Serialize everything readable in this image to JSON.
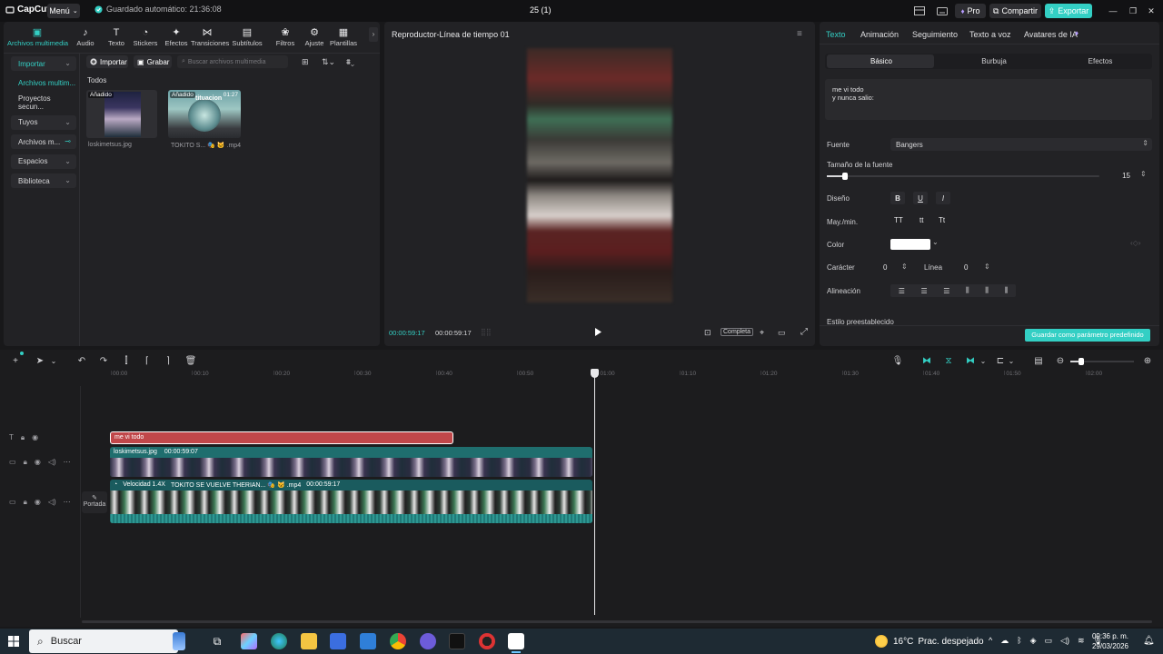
{
  "app": {
    "logo_text": "CapCut",
    "menu_label": "Menú",
    "autosave_text": "Guardado automático: 21:36:08",
    "project_title": "25 (1)",
    "pro_label": "Pro",
    "share_label": "Compartir",
    "export_label": "Exportar"
  },
  "media_panel": {
    "categories": [
      {
        "label": "Archivos multimedia",
        "icon": "media-icon",
        "active": true
      },
      {
        "label": "Audio",
        "icon": "audio-icon"
      },
      {
        "label": "Texto",
        "icon": "text-icon"
      },
      {
        "label": "Stickers",
        "icon": "sticker-icon"
      },
      {
        "label": "Efectos",
        "icon": "effects-icon"
      },
      {
        "label": "Transiciones",
        "icon": "transitions-icon"
      },
      {
        "label": "Subtítulos",
        "icon": "subtitles-icon"
      },
      {
        "label": "Filtros",
        "icon": "filters-icon"
      },
      {
        "label": "Ajuste",
        "icon": "adjust-icon"
      },
      {
        "label": "Plantillas",
        "icon": "templates-icon"
      }
    ],
    "sidebar": [
      {
        "label": "Importar",
        "chevron": true,
        "bg": true
      },
      {
        "label": "Archivos multim...",
        "active": true
      },
      {
        "label": "Proyectos secun..."
      },
      {
        "label": "Tuyos",
        "chevron": true
      },
      {
        "label": "Archivos m...",
        "toggle": true
      },
      {
        "label": "Espacios",
        "chevron": true
      },
      {
        "label": "Biblioteca",
        "chevron": true
      }
    ],
    "import_btn": "Importar",
    "record_btn": "Grabar",
    "search_placeholder": "Buscar archivos multimedia",
    "section_title": "Todos",
    "items": [
      {
        "badge": "Añadido",
        "name": "loskimetsus.jpg",
        "duration": ""
      },
      {
        "badge": "Añadido",
        "name": "TOKITO S... 🎭 🐱 .mp4",
        "duration": "01:27",
        "overlay": "tituacion"
      }
    ]
  },
  "player": {
    "title": "Reproductor-Línea de tiempo 01",
    "current_time": "00:00:59:17",
    "total_time": "00:00:59:17",
    "complete_label": "Completa"
  },
  "props": {
    "tabs": [
      "Texto",
      "Animación",
      "Seguimiento",
      "Texto a voz",
      "Avatares de IA"
    ],
    "subtabs": [
      "Básico",
      "Burbuja",
      "Efectos"
    ],
    "text_content": [
      "me vi todo",
      "y nunca salio:"
    ],
    "font_label": "Fuente",
    "font_value": "Bangers",
    "size_label": "Tamaño de la fuente",
    "size_value": "15",
    "size_fraction": 0.03,
    "design_label": "Diseño",
    "case_label": "May./min.",
    "case_options": [
      "TT",
      "tt",
      "Tt"
    ],
    "color_label": "Color",
    "color_value": "#ffffff",
    "char_label": "Carácter",
    "char_value": "0",
    "line_label": "Línea",
    "line_value": "0",
    "align_label": "Alineación",
    "preset_label": "Estilo preestablecido",
    "save_default_btn": "Guardar como parámetro predefinido"
  },
  "timeline": {
    "ticks": [
      "00:00",
      "00:10",
      "00:20",
      "00:30",
      "00:40",
      "00:50",
      "01:00",
      "01:10",
      "01:20",
      "01:30",
      "01:40",
      "01:50",
      "02:00"
    ],
    "text_clip": "me vi todo",
    "image_clip": {
      "name": "loskimetsus.jpg",
      "duration": "00:00:59:07"
    },
    "video_clip": {
      "speed": "Velocidad 1.4X",
      "name": "TOKITO SE VUELVE THERIAN... 🎭 🐱 .mp4",
      "duration": "00:00:59:17"
    },
    "cover_label": "Portada"
  },
  "taskbar": {
    "search_placeholder": "Buscar",
    "weather_temp": "16°C",
    "weather_desc": "Prac. despejado",
    "time": "09:36 p. m.",
    "date": "29/03/2026"
  },
  "colors": {
    "accent": "#33cfc4",
    "text_clip": "#c0474a",
    "image_clip": "#1f6e6e",
    "video_clip": "#1a5b5e"
  }
}
